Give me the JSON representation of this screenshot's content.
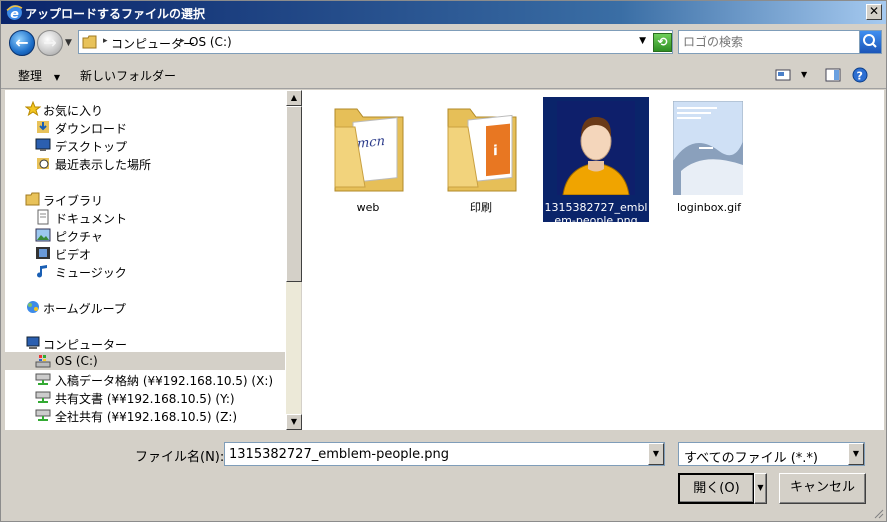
{
  "window": {
    "title": "アップロードするファイルの選択"
  },
  "address": {
    "crumbs": [
      "コンピューター",
      "OS (C:)"
    ],
    "search_placeholder": "ロゴの検索"
  },
  "toolbar": {
    "organize": "整理",
    "new_folder": "新しいフォルダー"
  },
  "nav": {
    "favorites": {
      "label": "お気に入り",
      "items": [
        "ダウンロード",
        "デスクトップ",
        "最近表示した場所"
      ]
    },
    "libraries": {
      "label": "ライブラリ",
      "items": [
        "ドキュメント",
        "ピクチャ",
        "ビデオ",
        "ミュージック"
      ]
    },
    "homegroup": "ホームグループ",
    "computer": {
      "label": "コンピューター",
      "items": [
        "OS (C:)",
        "入稿データ格納 (¥¥192.168.10.5) (X:)",
        "共有文書 (¥¥192.168.10.5) (Y:)",
        "全社共有 (¥¥192.168.10.5) (Z:)"
      ]
    }
  },
  "files": [
    {
      "name": "web",
      "type": "folder",
      "selected": false
    },
    {
      "name": "印刷",
      "type": "folder",
      "selected": false
    },
    {
      "name": "1315382727_emblem-people.png",
      "type": "image",
      "selected": true
    },
    {
      "name": "loginbox.gif",
      "type": "image",
      "selected": false
    }
  ],
  "bottom": {
    "filename_label": "ファイル名(N):",
    "filename_value": "1315382727_emblem-people.png",
    "filetype": "すべてのファイル (*.*)",
    "open_label": "開く(O)",
    "cancel_label": "キャンセル"
  },
  "colors": {
    "selection": "#0a246a",
    "titlebar": "#0a246a",
    "chrome": "#d4d0c8"
  }
}
